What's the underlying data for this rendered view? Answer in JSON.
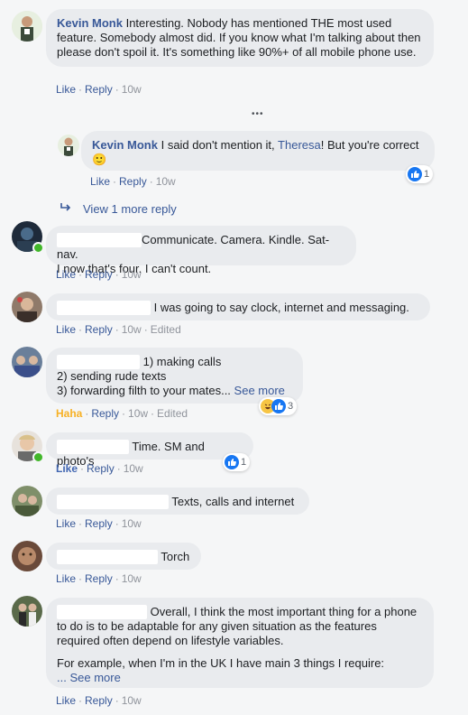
{
  "comments": [
    {
      "author": "Kevin Monk",
      "text": "Interesting. Nobody has mentioned THE most used feature. Somebody almost did. If you know what I'm talking about then please don't spoil it. It's something like 90%+ of all mobile phone use.",
      "like": "Like",
      "reply": "Reply",
      "time": "10w"
    },
    {
      "author": "Kevin Monk",
      "text_a": "I said don't mention it,",
      "mention": "Theresa",
      "text_b": "! But you're correct",
      "emoji": "🙂",
      "like": "Like",
      "reply": "Reply",
      "time": "10w",
      "reaction_count": "1"
    },
    {
      "text_1": "Communicate. Camera. Kindle. Sat-nav.",
      "text_2": "I now that's four. I can't count.",
      "like": "Like",
      "reply": "Reply",
      "time": "10w"
    },
    {
      "text": "I was going to say clock, internet and messaging.",
      "like": "Like",
      "reply": "Reply",
      "time": "10w",
      "edited": "Edited"
    },
    {
      "line1": "1) making calls",
      "line2": "2) sending rude texts",
      "line3": "3) forwarding filth to your mates...",
      "see_more": "See more",
      "reaction": "Haha",
      "reply": "Reply",
      "time": "10w",
      "edited": "Edited",
      "reaction_count": "3"
    },
    {
      "text": "Time. SM and photo's",
      "reaction": "Like",
      "reply": "Reply",
      "time": "10w",
      "reaction_count": "1"
    },
    {
      "text": "Texts, calls and internet",
      "like": "Like",
      "reply": "Reply",
      "time": "10w"
    },
    {
      "text": "Torch",
      "like": "Like",
      "reply": "Reply",
      "time": "10w"
    },
    {
      "text_1": "Overall, I think the most important thing for a phone to do is to be adaptable for any given situation as the features required often depend on lifestyle variables.",
      "text_2": "For example, when I'm in the UK I have main 3 things I require:",
      "see_more": "... See more",
      "like": "Like",
      "reply": "Reply",
      "time": "10w"
    }
  ],
  "more_menu": "•••",
  "view_more_reply": "View 1 more reply",
  "colors": {
    "link": "#385898",
    "bubble": "#e9ebee",
    "bg": "#f5f6f7",
    "like_blue": "#1877f2",
    "haha": "#f7b125"
  }
}
